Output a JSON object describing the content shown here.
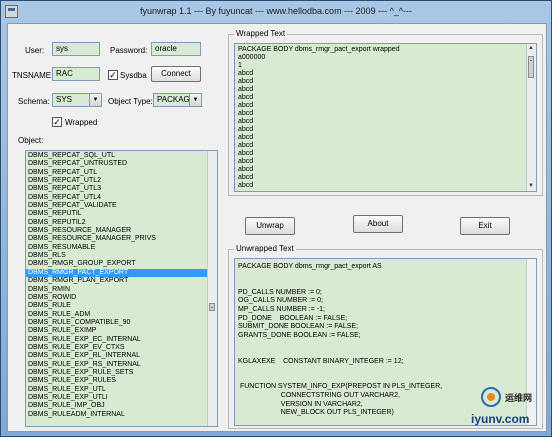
{
  "window": {
    "title": "fyunwrap 1.1 --- By fuyuncat --- www.hellodba.com --- 2009 --- ^_^---"
  },
  "login": {
    "user_label": "User:",
    "user_value": "sys",
    "password_label": "Password:",
    "password_value": "oracle",
    "tnsname_label": "TNSNAME:",
    "tnsname_value": "RAC",
    "sysdba_label": "Sysdba",
    "sysdba_checked": true,
    "connect_label": "Connect"
  },
  "filters": {
    "schema_label": "Schema:",
    "schema_value": "SYS",
    "object_type_label": "Object Type:",
    "object_type_value": "PACKAGE B",
    "wrapped_label": "Wrapped",
    "wrapped_checked": true
  },
  "objects": {
    "label": "Object:",
    "selected_index": 15,
    "items": [
      "DBMS_REPCAT_SQL_UTL",
      "DBMS_REPCAT_UNTRUSTED",
      "DBMS_REPCAT_UTL",
      "DBMS_REPCAT_UTL2",
      "DBMS_REPCAT_UTL3",
      "DBMS_REPCAT_UTL4",
      "DBMS_REPCAT_VALIDATE",
      "DBMS_REPUTIL",
      "DBMS_REPUTIL2",
      "DBMS_RESOURCE_MANAGER",
      "DBMS_RESOURCE_MANAGER_PRIVS",
      "DBMS_RESUMABLE",
      "DBMS_RLS",
      "DBMS_RMGR_GROUP_EXPORT",
      "DBMS_RMGR_PACT_EXPORT",
      "DBMS_RMGR_PLAN_EXPORT",
      "DBMS_RMIN",
      "DBMS_ROWID",
      "DBMS_RULE",
      "DBMS_RULE_ADM",
      "DBMS_RULE_COMPATIBLE_90",
      "DBMS_RULE_EXIMP",
      "DBMS_RULE_EXP_EC_INTERNAL",
      "DBMS_RULE_EXP_EV_CTXS",
      "DBMS_RULE_EXP_RL_INTERNAL",
      "DBMS_RULE_EXP_RS_INTERNAL",
      "DBMS_RULE_EXP_RULE_SETS",
      "DBMS_RULE_EXP_RULES",
      "DBMS_RULE_EXP_UTL",
      "DBMS_RULE_EXP_UTLI",
      "DBMS_RULE_IMP_OBJ",
      "DBMS_RULEADM_INTERNAL"
    ]
  },
  "wrapped_text": {
    "label": "Wrapped Text",
    "lines": [
      "PACKAGE BODY dbms_rmgr_pact_export wrapped",
      "a000000",
      "1",
      "abcd",
      "abcd",
      "abcd",
      "abcd",
      "abcd",
      "abcd",
      "abcd",
      "abcd",
      "abcd",
      "abcd",
      "abcd",
      "abcd",
      "abcd",
      "abcd",
      "abcd"
    ]
  },
  "buttons": {
    "unwrap": "Unwrap",
    "about": "About",
    "exit": "Exit"
  },
  "unwrapped_text": {
    "label": "Unwrapped Text",
    "lines": [
      "PACKAGE BODY dbms_rmgr_pact_export AS",
      "",
      "",
      "PD_CALLS NUMBER := 0;",
      "OG_CALLS NUMBER := 0;",
      "MP_CALLS NUMBER := -1;",
      "PD_DONE    BOOLEAN := FALSE;",
      "SUBMIT_DONE BOOLEAN := FALSE;",
      "GRANTS_DONE BOOLEAN := FALSE;",
      "",
      "",
      "KGLAXEXE    CONSTANT BINARY_INTEGER := 12;",
      "",
      "",
      " FUNCTION SYSTEM_INFO_EXP(PREPOST IN PLS_INTEGER,",
      "                      CONNECTSTRING OUT VARCHAR2,",
      "                      VERSION IN VARCHAR2,",
      "                      NEW_BLOCK OUT PLS_INTEGER)"
    ]
  },
  "watermark": {
    "site_cn": "运维网",
    "url": "iyunv.com"
  }
}
